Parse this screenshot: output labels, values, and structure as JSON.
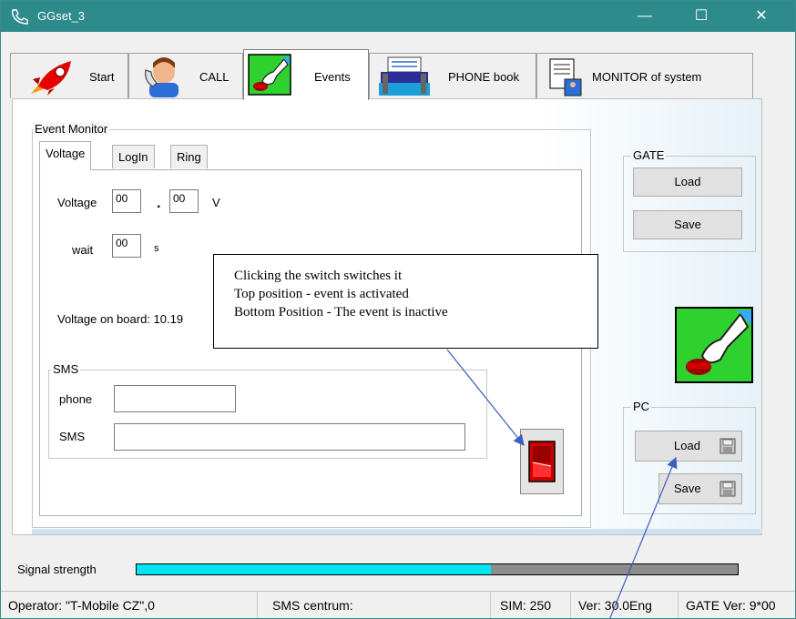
{
  "window": {
    "title": "GGset_3",
    "controls": {
      "minimize": "—",
      "maximize": "☐",
      "close": "✕"
    }
  },
  "tabs": [
    {
      "label": "Start",
      "icon": "rocket-icon"
    },
    {
      "label": "CALL",
      "icon": "telephone-caller-icon"
    },
    {
      "label": "Events",
      "icon": "hand-switch-icon",
      "active": true
    },
    {
      "label": "PHONE book",
      "icon": "address-book-icon"
    },
    {
      "label": "MONITOR of system",
      "icon": "monitor-document-icon"
    }
  ],
  "event_monitor": {
    "title": "Event Monitor",
    "subtabs": [
      "Voltage",
      "LogIn",
      "Ring"
    ],
    "active_subtab": "Voltage",
    "voltage_label": "Voltage",
    "voltage_int": "00",
    "voltage_dot": ".",
    "voltage_frac": "00",
    "voltage_unit": "V",
    "wait_label": "wait",
    "wait_value": "00",
    "wait_unit": "s",
    "voltage_on_board": "Voltage on board: 10.19",
    "sms_group": {
      "title": "SMS",
      "phone_label": "phone",
      "phone_value": "",
      "sms_label": "SMS",
      "sms_value": ""
    }
  },
  "gate": {
    "title": "GATE",
    "load": "Load",
    "save": "Save"
  },
  "pc": {
    "title": "PC",
    "load": "Load",
    "save": "Save"
  },
  "callout": {
    "line1": "Clicking the switch switches it",
    "line2": "Top position - event is activated",
    "line3": "Bottom Position - The event is inactive"
  },
  "signal": {
    "label": "Signal strength",
    "fraction": 0.59
  },
  "statusbar": {
    "operator": "Operator: \"T-Mobile CZ\",0",
    "sms_centrum": "SMS centrum:",
    "sim": "SIM: 250",
    "ver": "Ver: 30.0Eng",
    "gate_ver": "GATE Ver: 9*00"
  },
  "colors": {
    "titlebar": "#2e8b8b",
    "signal_fill": "#00e4f4",
    "switch_red": "#cc0000",
    "event_icon_green": "#22cc22"
  }
}
